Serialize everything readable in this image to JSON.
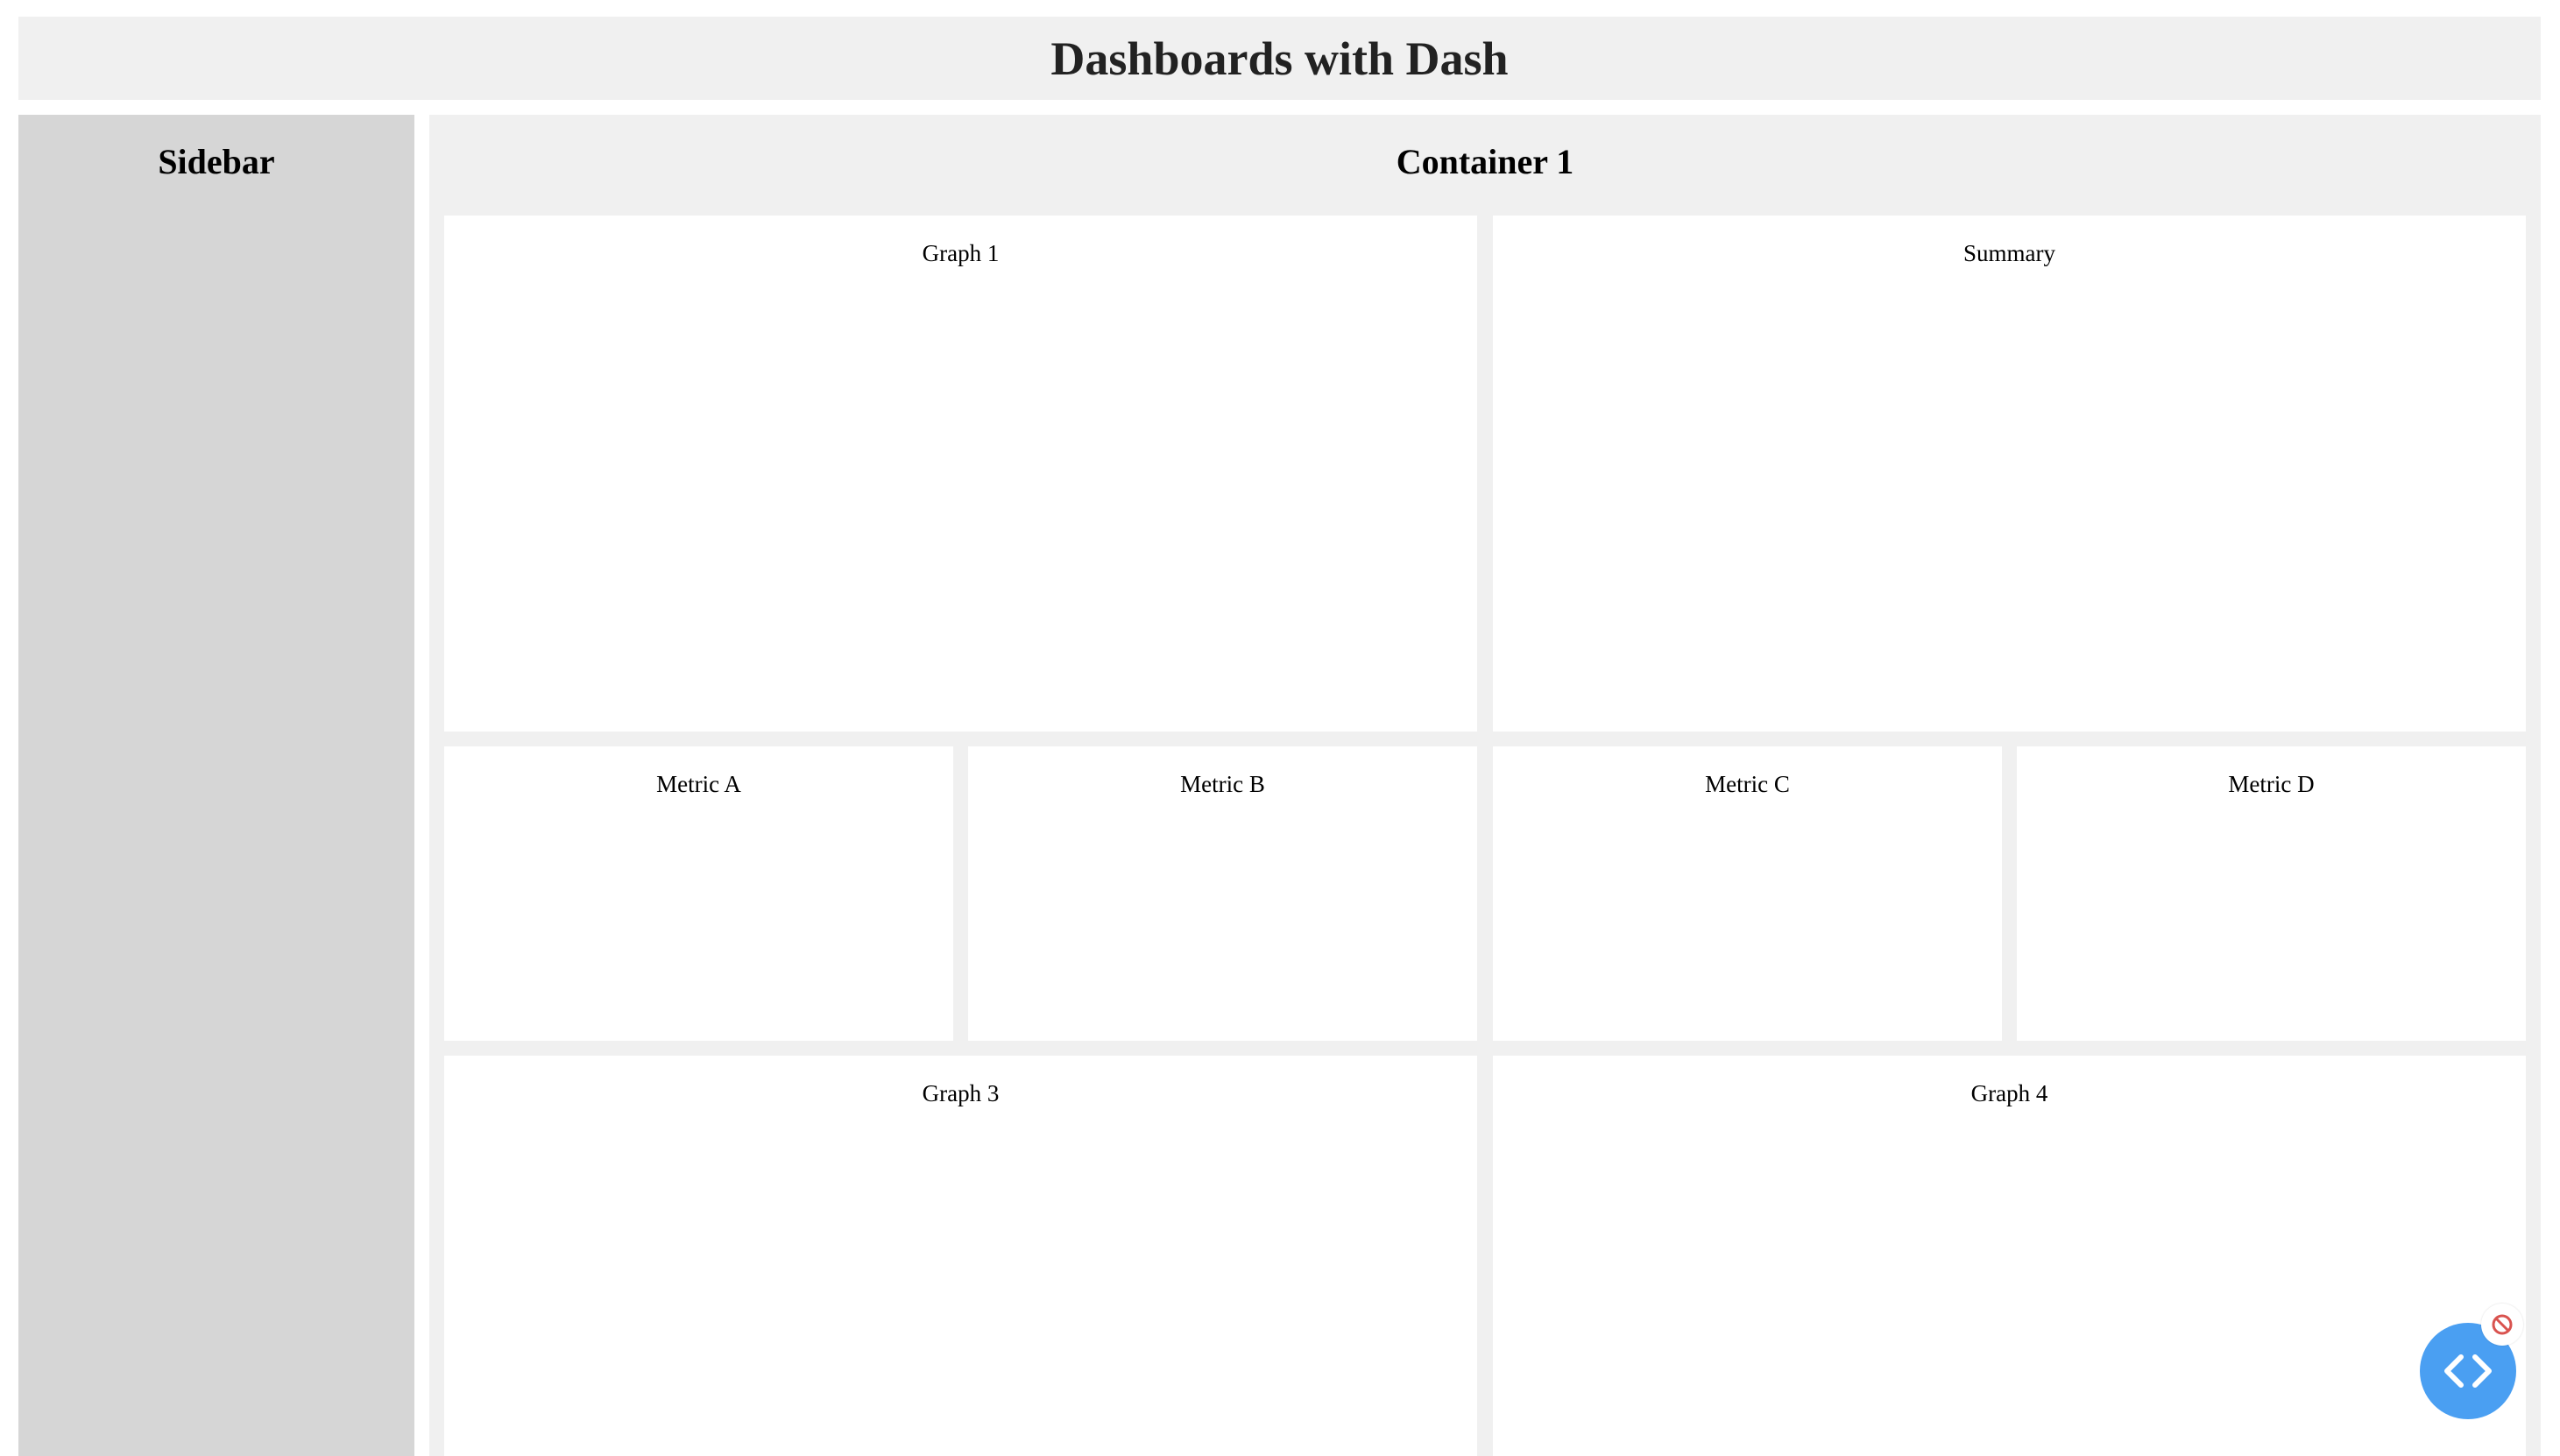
{
  "header": {
    "title": "Dashboards with Dash"
  },
  "sidebar": {
    "title": "Sidebar"
  },
  "container": {
    "title": "Container 1",
    "panels": {
      "graph1": "Graph 1",
      "summary": "Summary",
      "metric_a": "Metric A",
      "metric_b": "Metric B",
      "metric_c": "Metric C",
      "metric_d": "Metric D",
      "graph3": "Graph 3",
      "graph4": "Graph 4"
    }
  },
  "devtools": {
    "button_icon": "code-brackets-icon",
    "badge_icon": "blocked-icon"
  },
  "colors": {
    "header_bg": "#f0f0f0",
    "sidebar_bg": "#d6d6d6",
    "container_bg": "#f0f0f0",
    "panel_bg": "#ffffff",
    "fab_bg": "#4a9ff2",
    "badge_red": "#d9534f"
  }
}
